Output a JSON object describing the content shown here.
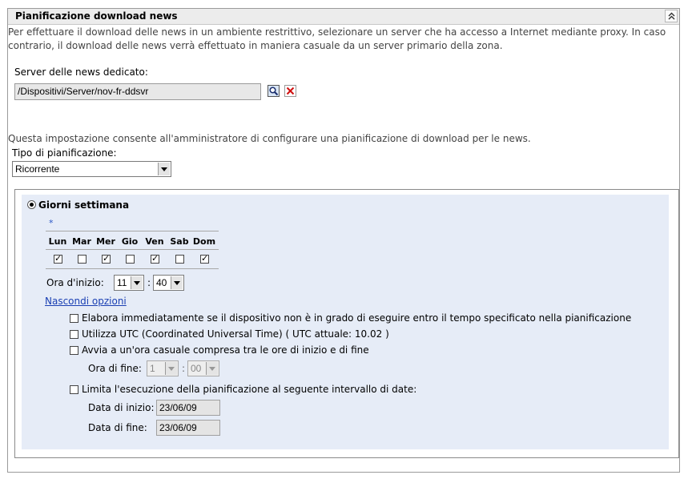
{
  "panel": {
    "title": "Pianificazione download news"
  },
  "intro": {
    "line1": "Per effettuare il download delle news in un ambiente restrittivo, selezionare un server che ha accesso a Internet mediante proxy. In caso",
    "line2": "contrario, il download delle news verrà effettuato in maniera casuale da un server primario della zona."
  },
  "server": {
    "label": "Server delle news dedicato:",
    "value": "/Dispositivi/Server/nov-fr-ddsvr"
  },
  "schedule": {
    "description": "Questa impostazione consente all'amministratore di configurare una pianificazione di download per le news.",
    "type_label": "Tipo di pianificazione:",
    "type_value": "Ricorrente",
    "mode_label": "Giorni settimana",
    "required_marker": "*",
    "days": [
      {
        "label": "Lun",
        "checked": true
      },
      {
        "label": "Mar",
        "checked": false
      },
      {
        "label": "Mer",
        "checked": true
      },
      {
        "label": "Gio",
        "checked": false
      },
      {
        "label": "Ven",
        "checked": true
      },
      {
        "label": "Sab",
        "checked": false
      },
      {
        "label": "Dom",
        "checked": true
      }
    ],
    "start_label": "Ora d'inizio:",
    "start_hour": "11",
    "start_minute": "40",
    "time_separator": ":",
    "hide_options_link": "Nascondi opzioni",
    "options": {
      "process_immediately": "Elabora immediatamente se il dispositivo non è in grado di eseguire entro il tempo specificato nella pianificazione",
      "use_utc": "Utilizza UTC (Coordinated Universal Time) ( UTC attuale: 10.02 )",
      "random_start": "Avvia a un'ora casuale compresa tra le ore di inizio e di fine",
      "end_time_label": "Ora di fine:",
      "end_hour": "1",
      "end_minute": "00",
      "limit_range": "Limita l'esecuzione della pianificazione al seguente intervallo di date:",
      "start_date_label": "Data di inizio:",
      "start_date": "23/06/09",
      "end_date_label": "Data di fine:",
      "end_date": "23/06/09"
    }
  },
  "colors": {
    "header_bg": "#ececec",
    "schedule_bg": "#e6ecf7",
    "link": "#1a3fb3",
    "required": "#2a56c6"
  }
}
